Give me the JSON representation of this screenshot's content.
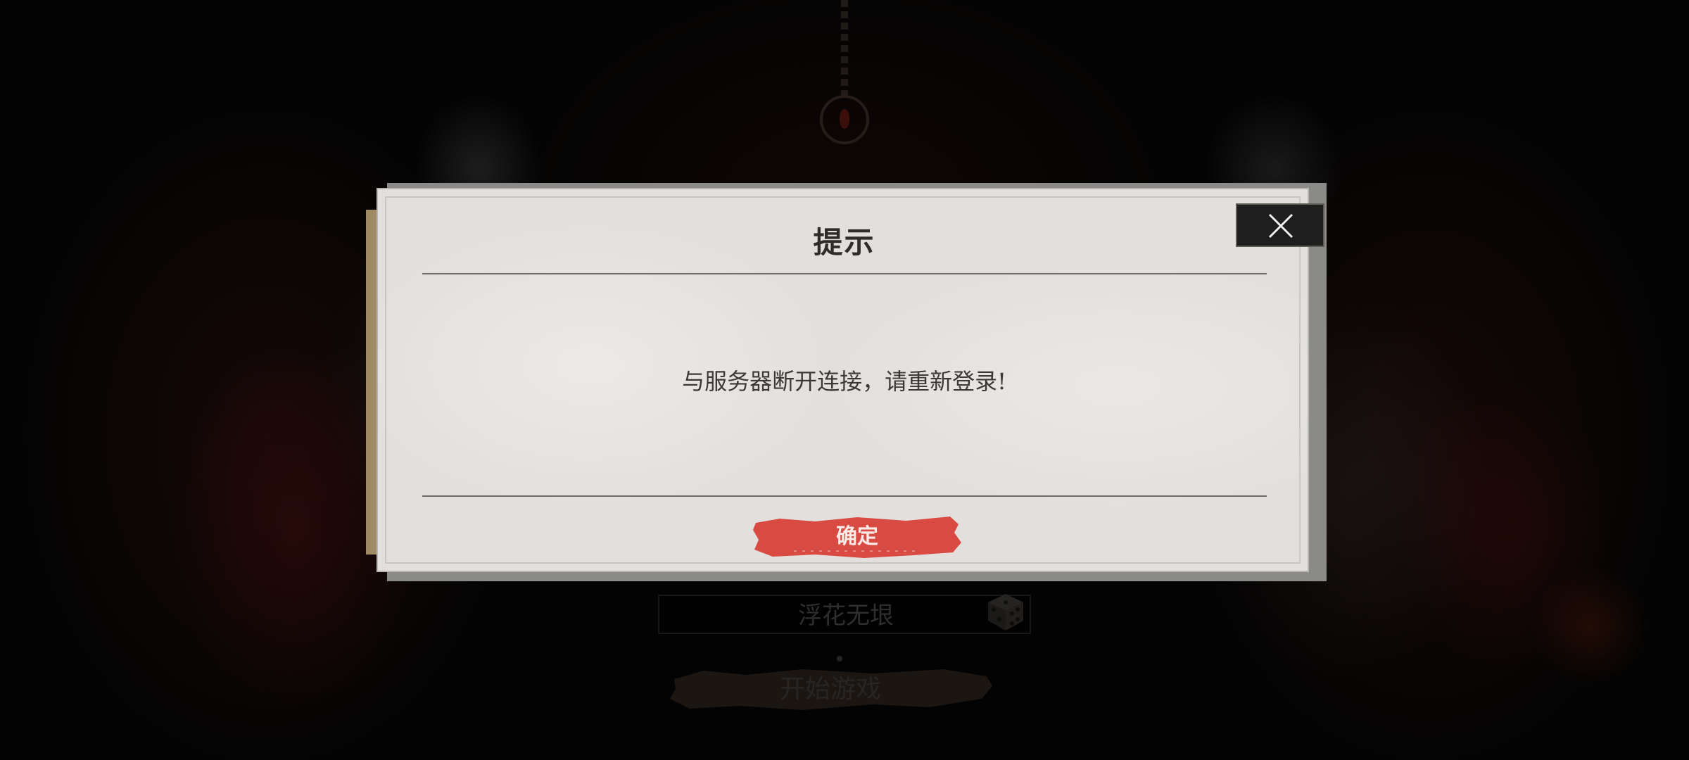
{
  "dialog": {
    "title": "提示",
    "message": "与服务器断开连接，请重新登录!",
    "confirm_label": "确定",
    "close_icon": "close-icon"
  },
  "login": {
    "server_name": "浮花无垠",
    "random_icon": "dice-icon",
    "start_label": "开始游戏"
  },
  "colors": {
    "confirm_button": "#d84a42",
    "paper": "#e2dfdc",
    "background": "#060606"
  }
}
